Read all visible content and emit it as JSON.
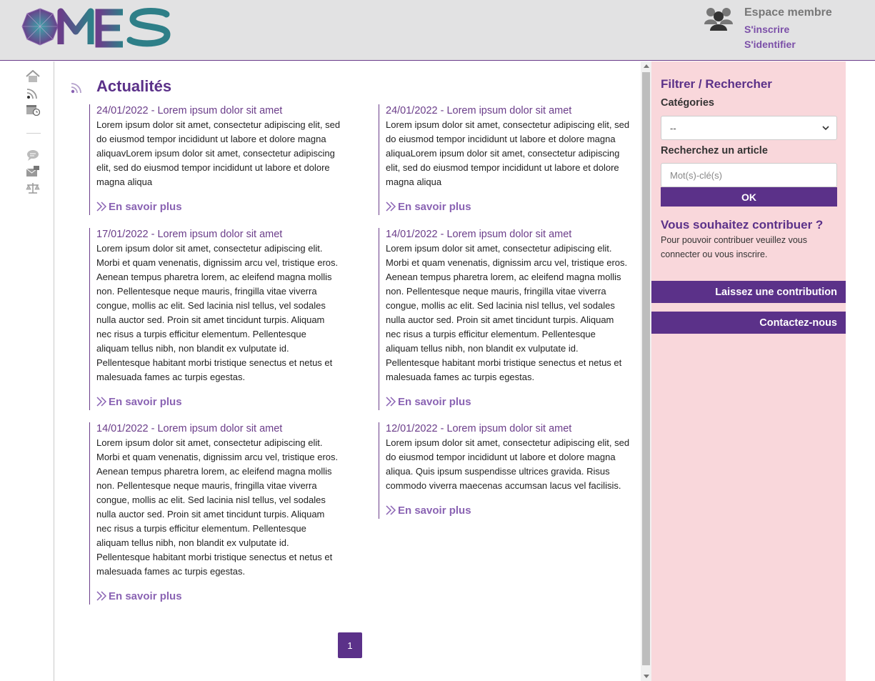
{
  "header": {
    "logo_text": "MES",
    "member": {
      "title": "Espace membre",
      "register": "S'inscrire",
      "login": "S'identifier"
    }
  },
  "rail": {
    "icons": [
      "home-icon",
      "rss-icon",
      "calendar-icon",
      "chat-icon",
      "mail-icon",
      "balance-icon"
    ]
  },
  "main": {
    "title": "Actualités",
    "more_label": "En savoir plus",
    "articles": [
      {
        "head": "24/01/2022 - Lorem ipsum dolor sit amet",
        "body": "Lorem ipsum dolor sit amet, consectetur adipiscing elit, sed do eiusmod tempor incididunt ut labore et dolore magna aliquavLorem ipsum dolor sit amet, consectetur adipiscing elit, sed do eiusmod tempor incididunt ut labore et dolore magna aliqua"
      },
      {
        "head": "24/01/2022 - Lorem ipsum dolor sit amet",
        "body": "Lorem ipsum dolor sit amet, consectetur adipiscing elit, sed do eiusmod tempor incididunt ut labore et dolore magna aliquaLorem ipsum dolor sit amet, consectetur adipiscing elit, sed do eiusmod tempor incididunt ut labore et dolore magna aliqua"
      },
      {
        "head": "17/01/2022 - Lorem ipsum dolor sit amet",
        "body": "Lorem ipsum dolor sit amet, consectetur adipiscing elit. Morbi et quam venenatis, dignissim arcu vel, tristique eros. Aenean tempus pharetra lorem, ac eleifend magna mollis non. Pellentesque neque mauris, fringilla vitae viverra congue, mollis ac elit. Sed lacinia nisl tellus, vel sodales nulla auctor sed. Proin sit amet tincidunt turpis. Aliquam nec risus a turpis efficitur elementum. Pellentesque aliquam tellus nibh, non blandit ex vulputate id. Pellentesque habitant morbi tristique senectus et netus et malesuada fames ac turpis egestas."
      },
      {
        "head": "14/01/2022 - Lorem ipsum dolor sit amet",
        "body": "Lorem ipsum dolor sit amet, consectetur adipiscing elit. Morbi et quam venenatis, dignissim arcu vel, tristique eros. Aenean tempus pharetra lorem, ac eleifend magna mollis non. Pellentesque neque mauris, fringilla vitae viverra congue, mollis ac elit. Sed lacinia nisl tellus, vel sodales nulla auctor sed. Proin sit amet tincidunt turpis. Aliquam nec risus a turpis efficitur elementum. Pellentesque aliquam tellus nibh, non blandit ex vulputate id. Pellentesque habitant morbi tristique senectus et netus et malesuada fames ac turpis egestas."
      },
      {
        "head": "14/01/2022 - Lorem ipsum dolor sit amet",
        "body": "Lorem ipsum dolor sit amet, consectetur adipiscing elit. Morbi et quam venenatis, dignissim arcu vel, tristique eros. Aenean tempus pharetra lorem, ac eleifend magna mollis non. Pellentesque neque mauris, fringilla vitae viverra congue, mollis ac elit. Sed lacinia nisl tellus, vel sodales nulla auctor sed. Proin sit amet tincidunt turpis. Aliquam nec risus a turpis efficitur elementum. Pellentesque aliquam tellus nibh, non blandit ex vulputate id. Pellentesque habitant morbi tristique senectus et netus et malesuada fames ac turpis egestas."
      },
      {
        "head": "12/01/2022 - Lorem ipsum dolor sit amet",
        "body": "Lorem ipsum dolor sit amet, consectetur adipiscing elit, sed do eiusmod tempor incididunt ut labore et dolore magna aliqua. Quis ipsum suspendisse ultrices gravida. Risus commodo viverra maecenas accumsan lacus vel facilisis."
      }
    ],
    "pagination": {
      "current": "1"
    }
  },
  "sidebar": {
    "filter_title": "Filtrer / Rechercher",
    "categories_label": "Catégories",
    "categories_selected": "--",
    "search_label": "Recherchez un article",
    "search_placeholder": "Mot(s)-clé(s)",
    "ok_label": "OK",
    "contrib_title": "Vous souhaitez contribuer ?",
    "contrib_text": "Pour pouvoir contribuer veuillez vous connecter ou vous inscrire.",
    "contrib_button": "Laissez une contribution",
    "contact_button": "Contactez-nous"
  },
  "colors": {
    "primary": "#5b3189",
    "accent_link": "#8a63b3",
    "header_bg": "#e2e2e3",
    "sidebar_bg": "#f9d7db"
  }
}
